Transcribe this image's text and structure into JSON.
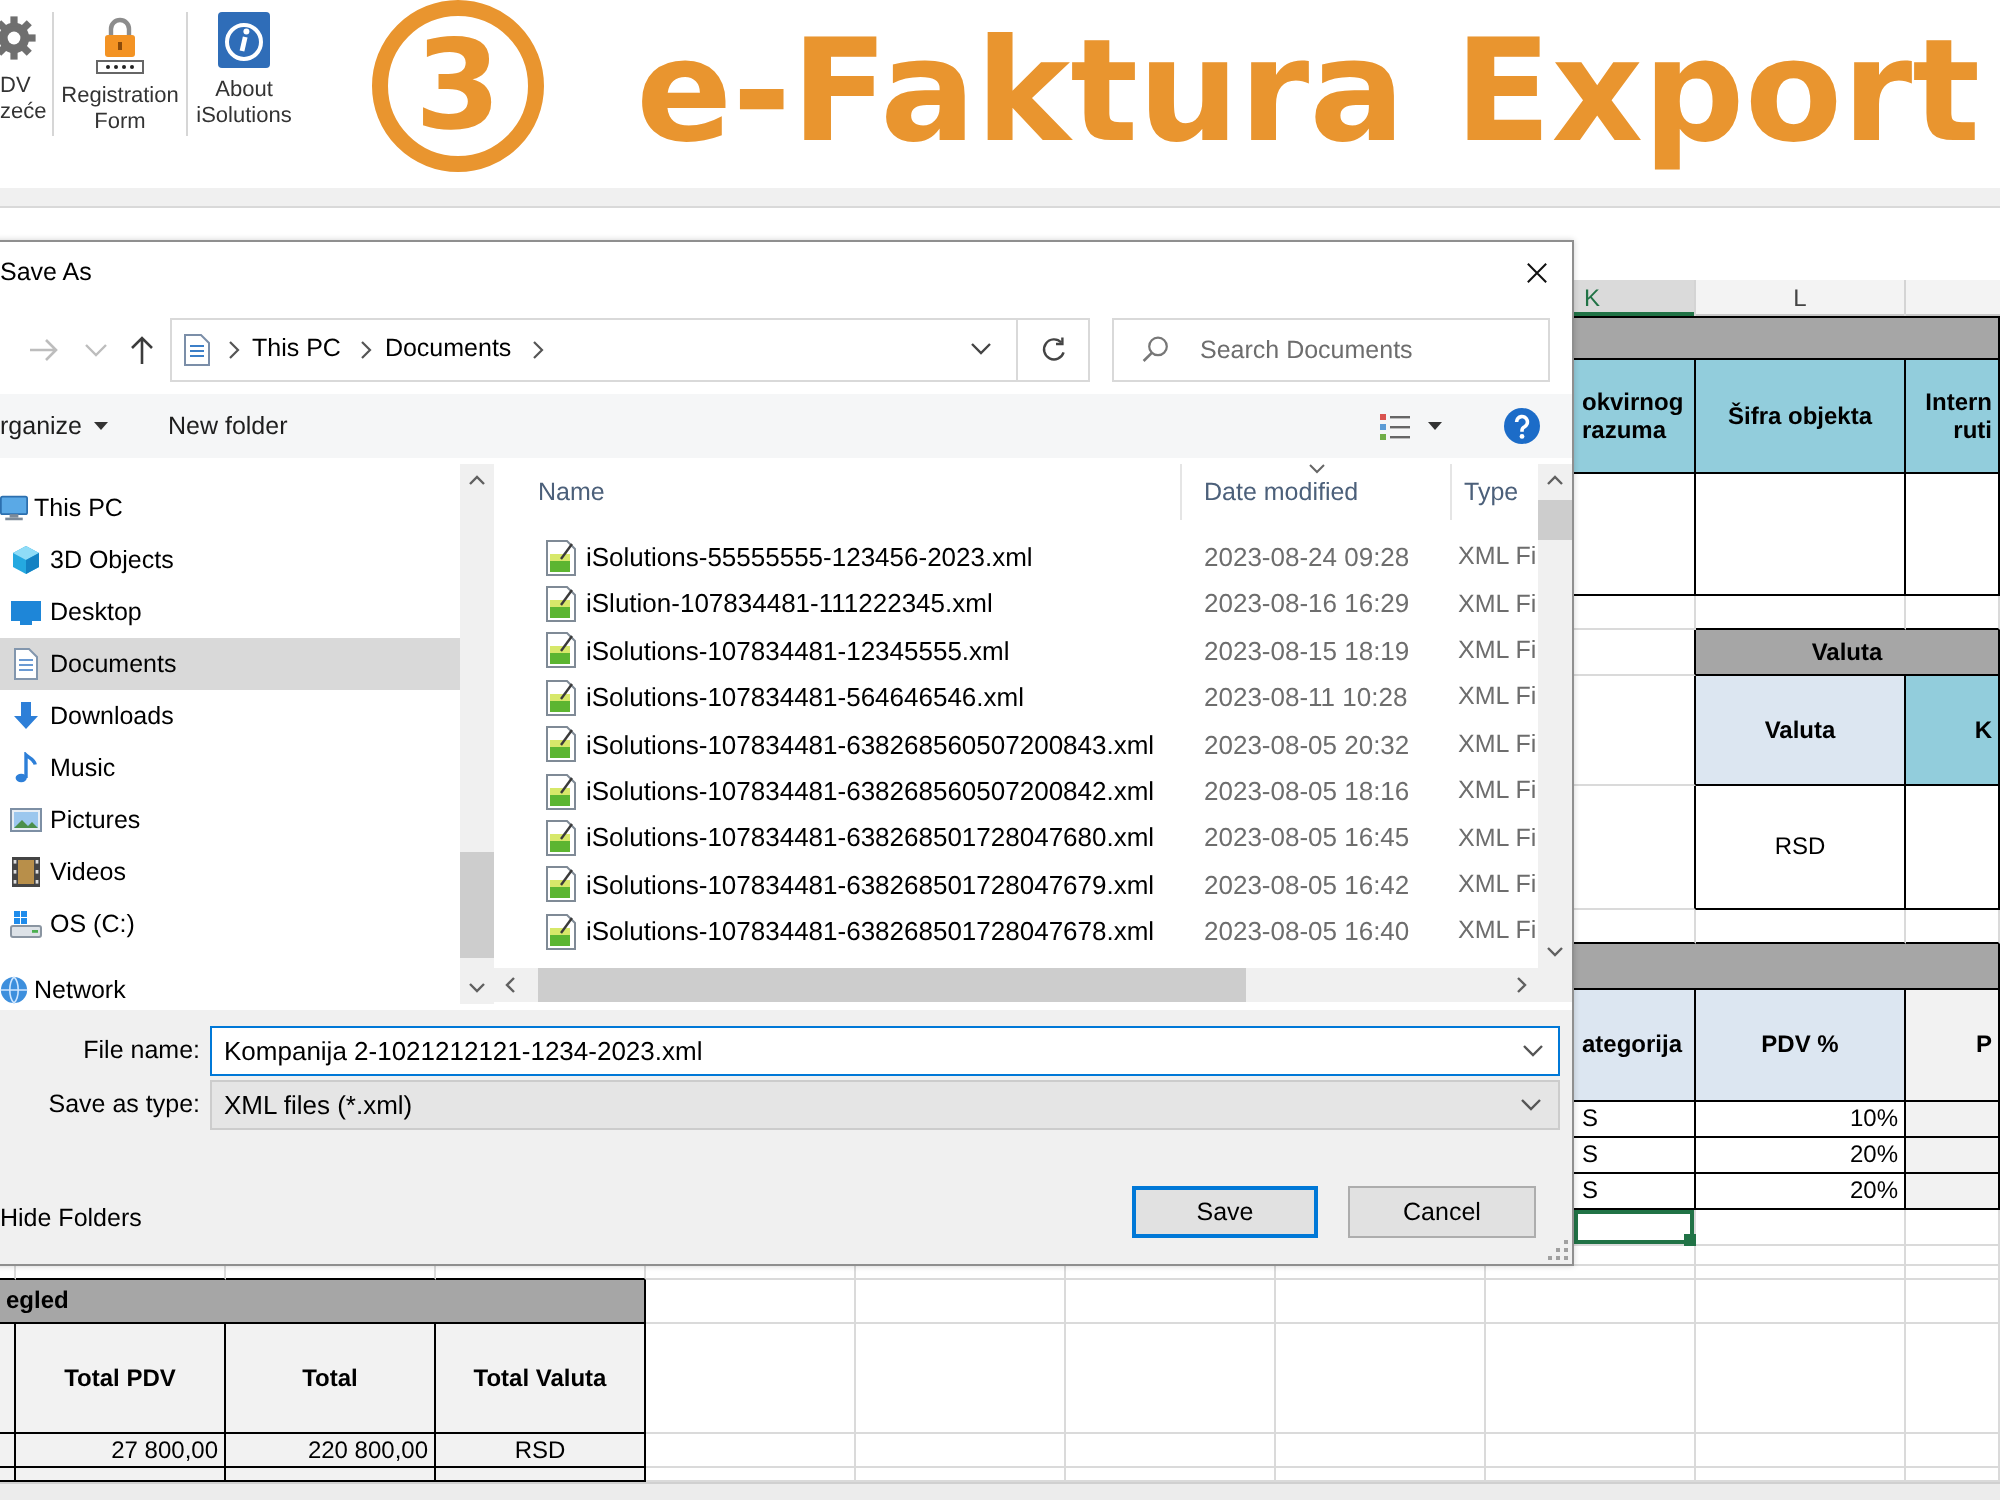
{
  "ribbon": {
    "buttons": [
      {
        "label": "DV zeće"
      },
      {
        "label": "Registration Form"
      },
      {
        "label": "About iSolutions"
      }
    ]
  },
  "banner": {
    "step": "3",
    "title": "e-Faktura Export"
  },
  "dialog": {
    "title": "Save As",
    "nav_buttons": [
      {
        "disabled": true
      },
      {
        "disabled": true
      },
      {
        "disabled": false
      }
    ],
    "address": {
      "breadcrumbs": [
        "This PC",
        "Documents"
      ]
    },
    "search": {
      "placeholder": "Search Documents"
    },
    "toolbar": {
      "items": [
        {
          "label": "rganize",
          "dropdown": true
        },
        {
          "label": "New folder",
          "dropdown": false
        }
      ]
    },
    "nav_pane": {
      "items": [
        {
          "label": "This PC",
          "selected": false,
          "children": [
            {
              "label": "3D Objects",
              "selected": false
            },
            {
              "label": "Desktop",
              "selected": false
            },
            {
              "label": "Documents",
              "selected": true
            },
            {
              "label": "Downloads",
              "selected": false
            },
            {
              "label": "Music",
              "selected": false
            },
            {
              "label": "Pictures",
              "selected": false
            },
            {
              "label": "Videos",
              "selected": false
            },
            {
              "label": "OS (C:)",
              "selected": false
            }
          ]
        },
        {
          "label": "Network",
          "selected": false
        }
      ]
    },
    "file_list": {
      "columns": [
        {
          "label": "Name",
          "sorted": false
        },
        {
          "label": "Date modified",
          "sorted": true
        },
        {
          "label": "Type",
          "sorted": false
        }
      ],
      "rows": [
        {
          "name": "iSolutions-55555555-123456-2023.xml",
          "date": "2023-08-24 09:28",
          "type": "XML Fi",
          "selected": false
        },
        {
          "name": "iSlution-107834481-111222345.xml",
          "date": "2023-08-16 16:29",
          "type": "XML Fi",
          "selected": false
        },
        {
          "name": "iSolutions-107834481-12345555.xml",
          "date": "2023-08-15 18:19",
          "type": "XML Fi",
          "selected": false
        },
        {
          "name": "iSolutions-107834481-564646546.xml",
          "date": "2023-08-11 10:28",
          "type": "XML Fi",
          "selected": false
        },
        {
          "name": "iSolutions-107834481-638268560507200843.xml",
          "date": "2023-08-05 20:32",
          "type": "XML Fi",
          "selected": false
        },
        {
          "name": "iSolutions-107834481-638268560507200842.xml",
          "date": "2023-08-05 18:16",
          "type": "XML Fi",
          "selected": false
        },
        {
          "name": "iSolutions-107834481-638268501728047680.xml",
          "date": "2023-08-05 16:45",
          "type": "XML Fi",
          "selected": false
        },
        {
          "name": "iSolutions-107834481-638268501728047679.xml",
          "date": "2023-08-05 16:42",
          "type": "XML Fi",
          "selected": false
        },
        {
          "name": "iSolutions-107834481-638268501728047678.xml",
          "date": "2023-08-05 16:40",
          "type": "XML Fi",
          "selected": false
        }
      ]
    },
    "file_name": {
      "label": "File name:",
      "value": "Kompanija 2-1021212121-1234-2023.xml"
    },
    "save_as_type": {
      "label": "Save as type:",
      "value": "XML files (*.xml)"
    },
    "hide_folders": {
      "label": "Hide Folders"
    },
    "buttons": [
      {
        "label": "Save",
        "default": true
      },
      {
        "label": "Cancel",
        "default": false
      }
    ]
  },
  "sheet": {
    "column_headers": [
      {
        "label": "K",
        "selected": true
      },
      {
        "label": "L",
        "selected": false
      }
    ],
    "right_rows": [
      {
        "cells": [
          {
            "kind": "bar",
            "selected": false
          },
          {
            "kind": "bar",
            "selected": false
          },
          {
            "kind": "bar",
            "selected": false
          }
        ]
      },
      {
        "cells": [
          {
            "kind": "head",
            "text": "okvirnog razuma",
            "selected": false
          },
          {
            "kind": "head",
            "text": "Šifra objekta",
            "selected": false
          },
          {
            "kind": "head",
            "text": "Intern ruti",
            "selected": false
          }
        ]
      },
      {
        "cells": [
          {
            "kind": "cell",
            "selected": false
          },
          {
            "kind": "cell",
            "selected": false
          },
          {
            "kind": "cell",
            "selected": false
          }
        ]
      },
      {
        "cells": [
          {
            "kind": "grid",
            "selected": false
          },
          {
            "kind": "grid",
            "selected": false
          },
          {
            "kind": "grid",
            "selected": false
          }
        ]
      },
      {
        "cells": [
          {
            "kind": "grid",
            "selected": false
          },
          {
            "kind": "bar",
            "text": "Valuta",
            "selected": false
          },
          {
            "kind": "bar",
            "selected": false
          }
        ]
      },
      {
        "cells": [
          {
            "kind": "grid",
            "selected": false
          },
          {
            "kind": "subhead",
            "text": "Valuta",
            "selected": false
          },
          {
            "kind": "head",
            "text": "K",
            "selected": false
          }
        ]
      },
      {
        "cells": [
          {
            "kind": "grid",
            "selected": false
          },
          {
            "kind": "cell",
            "text": "RSD",
            "selected": false
          },
          {
            "kind": "cell",
            "selected": false
          }
        ]
      },
      {
        "cells": [
          {
            "kind": "grid",
            "selected": false
          },
          {
            "kind": "grid",
            "selected": false
          },
          {
            "kind": "grid",
            "selected": false
          }
        ]
      },
      {
        "cells": [
          {
            "kind": "bar",
            "selected": false
          },
          {
            "kind": "bar",
            "selected": false
          },
          {
            "kind": "bar",
            "selected": false
          }
        ]
      },
      {
        "cells": [
          {
            "kind": "subhead",
            "text": "ategorija",
            "selected": false
          },
          {
            "kind": "subhead",
            "text": "PDV %",
            "selected": false
          },
          {
            "kind": "shadehead",
            "text": "P",
            "selected": false
          }
        ]
      },
      {
        "cells": [
          {
            "kind": "text",
            "text": "S",
            "selected": false
          },
          {
            "kind": "num",
            "text": "10%",
            "selected": false
          },
          {
            "kind": "shade",
            "selected": false
          }
        ]
      },
      {
        "cells": [
          {
            "kind": "text",
            "text": "S",
            "selected": false
          },
          {
            "kind": "num",
            "text": "20%",
            "selected": false
          },
          {
            "kind": "shade",
            "selected": false
          }
        ]
      },
      {
        "cells": [
          {
            "kind": "text",
            "text": "S",
            "selected": false
          },
          {
            "kind": "num",
            "text": "20%",
            "selected": false
          },
          {
            "kind": "shade",
            "selected": false
          }
        ]
      },
      {
        "cells": [
          {
            "kind": "grid",
            "selected": true
          },
          {
            "kind": "grid",
            "selected": false
          },
          {
            "kind": "grid",
            "selected": false
          }
        ]
      },
      {
        "cells": [
          {
            "kind": "grid",
            "selected": false
          },
          {
            "kind": "grid",
            "selected": false
          },
          {
            "kind": "grid",
            "selected": false
          }
        ]
      }
    ],
    "bottom_rows": [
      {
        "cells": [
          {
            "kind": "grid"
          },
          {
            "kind": "grid"
          },
          {
            "kind": "grid"
          },
          {
            "kind": "grid"
          }
        ]
      },
      {
        "cells": [
          {
            "kind": "bar",
            "text": "egled"
          },
          {
            "kind": "bar"
          },
          {
            "kind": "bar"
          },
          {
            "kind": "bar"
          }
        ]
      },
      {
        "cells": [
          {
            "kind": "shadehead"
          },
          {
            "kind": "shadehead",
            "text": "Total PDV"
          },
          {
            "kind": "shadehead",
            "text": "Total"
          },
          {
            "kind": "shadehead",
            "text": "Total Valuta"
          }
        ]
      },
      {
        "cells": [
          {
            "kind": "shade"
          },
          {
            "kind": "shadenum",
            "text": "27 800,00"
          },
          {
            "kind": "shadenum",
            "text": "220 800,00"
          },
          {
            "kind": "shade",
            "text": "RSD"
          }
        ]
      },
      {
        "cells": [
          {
            "kind": "shade"
          },
          {
            "kind": "shade"
          },
          {
            "kind": "shade"
          },
          {
            "kind": "shade"
          }
        ]
      }
    ]
  }
}
